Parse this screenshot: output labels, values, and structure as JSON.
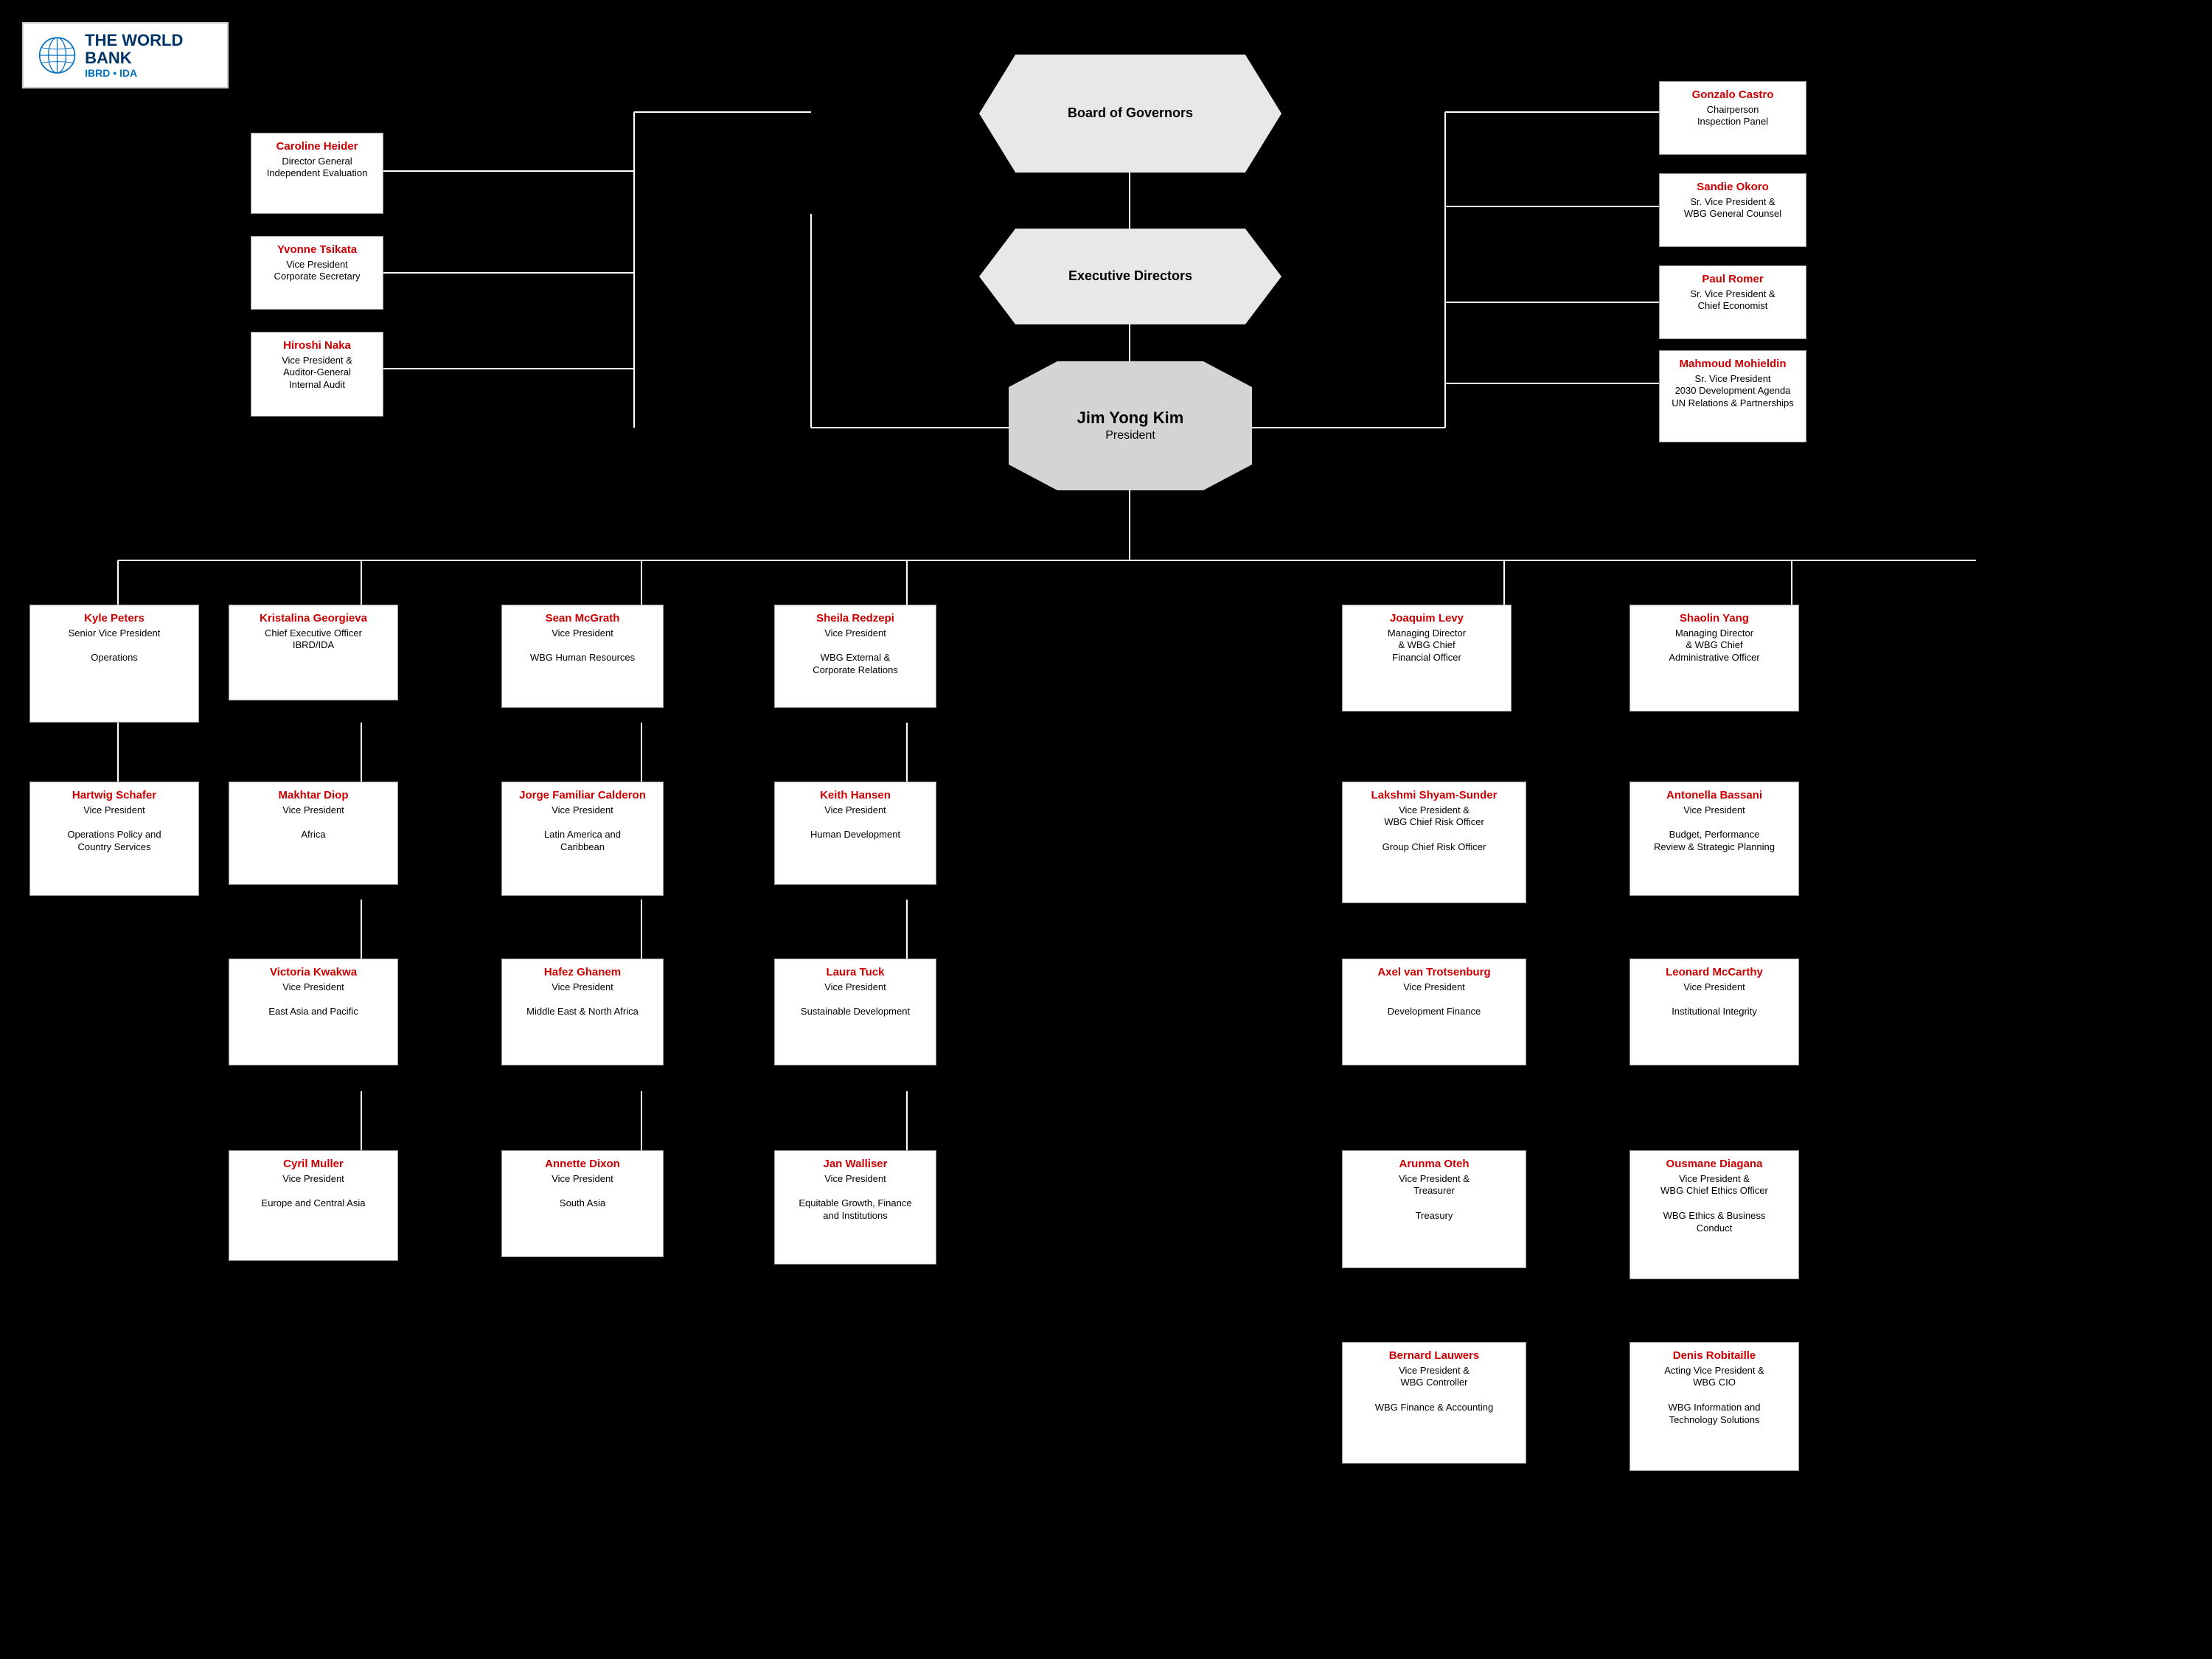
{
  "logo": {
    "title": "THE WORLD BANK",
    "subtitle": "IBRD • IDA"
  },
  "topLevel": {
    "board": "Board of Governors",
    "execDir": "Executive Directors",
    "president_name": "Jim Yong Kim",
    "president_title": "President"
  },
  "leftColumn": [
    {
      "name": "Caroline Heider",
      "title": "Director General\nIndependent Evaluation"
    },
    {
      "name": "Yvonne Tsikata",
      "title": "Vice President\nCorporate Secretary"
    },
    {
      "name": "Hiroshi Naka",
      "title": "Vice President &\nAuditor-General\nInternal Audit"
    }
  ],
  "rightColumn": [
    {
      "name": "Gonzalo Castro",
      "title": "Chairperson\nInspection Panel"
    },
    {
      "name": "Sandie Okoro",
      "title": "Sr. Vice President &\nWBG General Counsel"
    },
    {
      "name": "Paul Romer",
      "title": "Sr. Vice President &\nChief Economist"
    },
    {
      "name": "Mahmoud Mohieldin",
      "title": "Sr. Vice President\n2030 Development Agenda\nUN Relations & Partnerships"
    }
  ],
  "midLevel": [
    {
      "name": "Kyle Peters",
      "title": "Senior Vice President\n\nOperations",
      "col": 0
    },
    {
      "name": "Kristalina Georgieva",
      "title": "Chief Executive Officer\nIBRD/IDA",
      "col": 1
    },
    {
      "name": "Sean McGrath",
      "title": "Vice President\n\nWBG Human Resources",
      "col": 2
    },
    {
      "name": "Sheila Redzepi",
      "title": "Vice President\n\nWBG External &\nCorporate Relations",
      "col": 3
    },
    {
      "name": "Joaquim Levy",
      "title": "Managing Director\n& WBG Chief\nFinancial Officer",
      "col": 4
    },
    {
      "name": "Shaolin Yang",
      "title": "Managing Director\n& WBG Chief\nAdministrative Officer",
      "col": 5
    }
  ],
  "row2": [
    {
      "name": "Hartwig Schafer",
      "title": "Vice President\n\nOperations Policy and\nCountry Services",
      "col": 0
    },
    {
      "name": "Makhtar Diop",
      "title": "Vice President\n\nAfrica",
      "col": 1
    },
    {
      "name": "Jorge Familiar Calderon",
      "title": "Vice President\n\nLatin America and\nCaribbean",
      "col": 2
    },
    {
      "name": "Keith Hansen",
      "title": "Vice President\n\nHuman Development",
      "col": 3
    },
    {
      "name": "Lakshmi Shyam-Sunder",
      "title": "Vice President &\nWBG Chief Risk Officer\n\nGroup Chief Risk Officer",
      "col": 4
    },
    {
      "name": "Antonella Bassani",
      "title": "Vice President\n\nBudget, Performance\nReview & Strategic Planning",
      "col": 5
    }
  ],
  "row3": [
    {
      "name": "Victoria Kwakwa",
      "title": "Vice President\n\nEast Asia and Pacific",
      "col": 1
    },
    {
      "name": "Hafez Ghanem",
      "title": "Vice President\n\nMiddle East & North Africa",
      "col": 2
    },
    {
      "name": "Laura Tuck",
      "title": "Vice President\n\nSustainable Development",
      "col": 3
    },
    {
      "name": "Axel van Trotsenburg",
      "title": "Vice President\n\nDevelopment Finance",
      "col": 4
    },
    {
      "name": "Leonard McCarthy",
      "title": "Vice President\n\nInstitutional Integrity",
      "col": 5
    }
  ],
  "row4": [
    {
      "name": "Cyril Muller",
      "title": "Vice President\n\nEurope and Central Asia",
      "col": 1
    },
    {
      "name": "Annette Dixon",
      "title": "Vice President\n\nSouth Asia",
      "col": 2
    },
    {
      "name": "Jan Walliser",
      "title": "Vice President\n\nEquitable Growth, Finance\nand Institutions",
      "col": 3
    },
    {
      "name": "Arunma Oteh",
      "title": "Vice President &\nTreasurer\n\nTreasury",
      "col": 4
    },
    {
      "name": "Ousmane Diagana",
      "title": "Vice President  &\nWBG Chief Ethics Officer\n\nWBG Ethics & Business\nConduct",
      "col": 5
    }
  ],
  "row5": [
    {
      "name": "Bernard Lauwers",
      "title": "Vice President &\nWBG Controller\n\nWBG Finance & Accounting",
      "col": 4
    },
    {
      "name": "Denis Robitaille",
      "title": "Acting Vice President &\nWBG CIO\n\nWBG Information and\nTechnology Solutions",
      "col": 5
    }
  ]
}
